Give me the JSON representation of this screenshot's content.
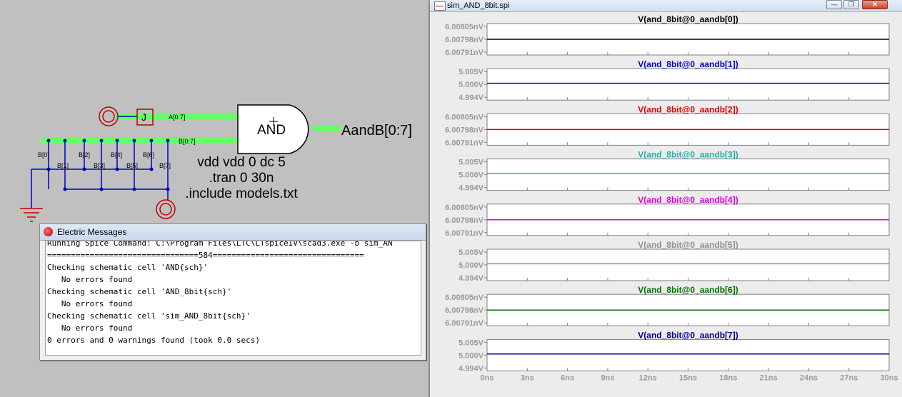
{
  "schematic": {
    "gate_label": "AND",
    "bus_a_label": "A[0:7]",
    "bus_b_label": "B[0:7]",
    "output_label": "AandB[0:7]",
    "tap_labels_top": [
      "B[0]",
      "B[2]",
      "B[4]",
      "B[6]"
    ],
    "tap_labels_bottom": [
      "B[1]",
      "B[3]",
      "B[5]",
      "B[7]"
    ],
    "spice_lines": [
      "vdd vdd 0 dc 5",
      ".tran 0 30n",
      ".include models.txt"
    ],
    "bus_color": "#66ff66"
  },
  "messages": {
    "title": "Electric Messages",
    "lines": [
      "Running Spice Command: C:\\Program Files\\LTC\\LTspiceIV\\scad3.exe -b sim_AN",
      "================================584================================",
      "Checking schematic cell 'AND{sch}'",
      "   No errors found",
      "Checking schematic cell 'AND_8bit{sch}'",
      "   No errors found",
      "Checking schematic cell 'sim_AND_8bit{sch}'",
      "   No errors found",
      "0 errors and 0 warnings found (took 0.0 secs)"
    ]
  },
  "plot_window": {
    "title": "sim_AND_8bit.spi",
    "minimize_glyph": "—",
    "restore_glyph": "❐",
    "close_glyph": "✕"
  },
  "chart_data": {
    "type": "line",
    "x_ticks": [
      "0ns",
      "3ns",
      "6ns",
      "9ns",
      "12ns",
      "15ns",
      "18ns",
      "21ns",
      "24ns",
      "27ns",
      "30ns"
    ],
    "xlim": [
      0,
      30
    ],
    "panels": [
      {
        "title": "V(and_8bit@0_aandb[0])",
        "color": "#000000",
        "y_ticks": [
          "6.00805nV",
          "6.00798nV",
          "6.00791nV"
        ],
        "ylim": [
          6.00791,
          6.00805
        ],
        "points": [
          [
            0,
            6.00798
          ],
          [
            15,
            6.00798
          ],
          [
            30,
            6.00798
          ]
        ]
      },
      {
        "title": "V(and_8bit@0_aandb[1])",
        "color": "#0000cc",
        "y_ticks": [
          "5.005V",
          "5.000V",
          "4.994V"
        ],
        "ylim": [
          4.994,
          5.005
        ],
        "points": [
          [
            0,
            5.0
          ],
          [
            30,
            5.0
          ]
        ]
      },
      {
        "title": "V(and_8bit@0_aandb[2])",
        "color": "#e00000",
        "y_ticks": [
          "6.00805nV",
          "6.00798nV",
          "6.00791nV"
        ],
        "ylim": [
          6.00791,
          6.00805
        ],
        "points": [
          [
            0,
            6.00798
          ],
          [
            10,
            6.00798
          ],
          [
            20,
            6.00798
          ],
          [
            30,
            6.00798
          ]
        ]
      },
      {
        "title": "V(and_8bit@0_aandb[3])",
        "color": "#20b0b0",
        "y_ticks": [
          "5.005V",
          "5.000V",
          "4.994V"
        ],
        "ylim": [
          4.994,
          5.005
        ],
        "points": [
          [
            0,
            5.0
          ],
          [
            30,
            5.0
          ]
        ]
      },
      {
        "title": "V(and_8bit@0_aandb[4])",
        "color": "#e000e0",
        "y_ticks": [
          "6.00805nV",
          "6.00798nV",
          "6.00791nV"
        ],
        "ylim": [
          6.00791,
          6.00805
        ],
        "points": [
          [
            0,
            6.00798
          ],
          [
            10,
            6.00798
          ],
          [
            20,
            6.00798
          ],
          [
            30,
            6.00798
          ]
        ]
      },
      {
        "title": "V(and_8bit@0_aandb[5])",
        "color": "#909090",
        "y_ticks": [
          "5.005V",
          "5.000V",
          "4.994V"
        ],
        "ylim": [
          4.994,
          5.005
        ],
        "points": [
          [
            0,
            5.0
          ],
          [
            30,
            5.0
          ]
        ]
      },
      {
        "title": "V(and_8bit@0_aandb[6])",
        "color": "#007000",
        "y_ticks": [
          "6.00805nV",
          "6.00798nV",
          "6.00791nV"
        ],
        "ylim": [
          6.00791,
          6.00805
        ],
        "points": [
          [
            0,
            6.00798
          ],
          [
            10,
            6.00798
          ],
          [
            20,
            6.00798
          ],
          [
            30,
            6.00798
          ]
        ]
      },
      {
        "title": "V(and_8bit@0_aandb[7])",
        "color": "#000090",
        "y_ticks": [
          "5.005V",
          "5.000V",
          "4.994V"
        ],
        "ylim": [
          4.994,
          5.005
        ],
        "points": [
          [
            0,
            5.0
          ],
          [
            30,
            5.0
          ]
        ]
      }
    ]
  }
}
